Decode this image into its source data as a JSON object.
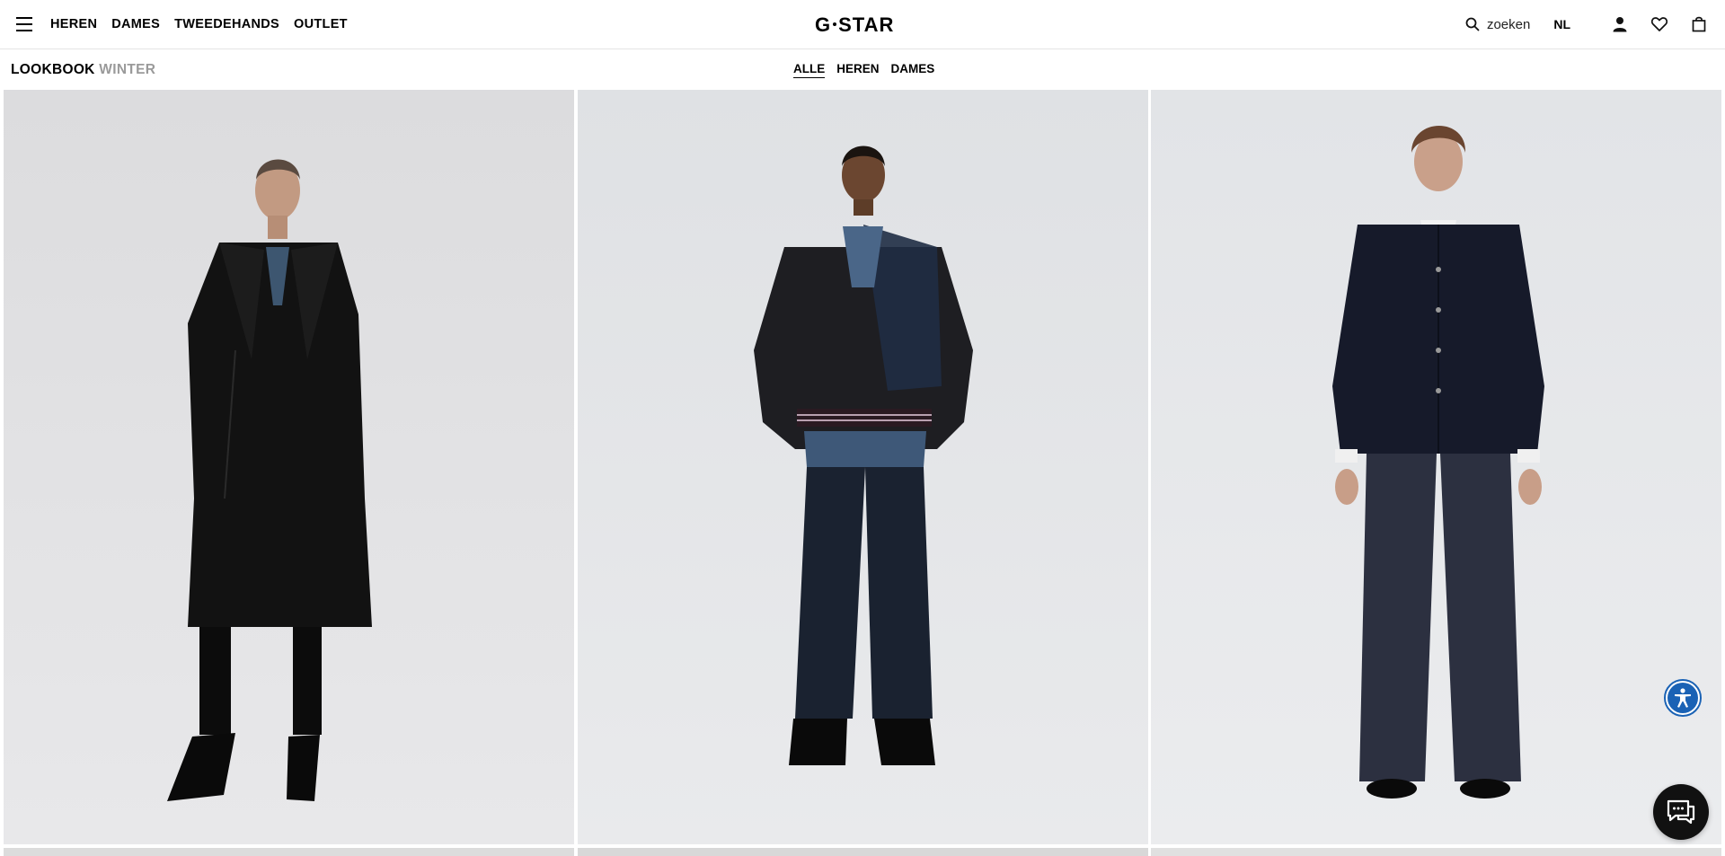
{
  "header": {
    "menu_icon": "hamburger-menu-icon",
    "nav": [
      {
        "label": "HEREN"
      },
      {
        "label": "DAMES"
      },
      {
        "label": "TWEEDEHANDS"
      },
      {
        "label": "OUTLET"
      }
    ],
    "logo_left": "G",
    "logo_right": "STAR",
    "search": {
      "icon": "search-icon",
      "label": "zoeken"
    },
    "language": "NL",
    "icons": [
      "account-icon",
      "wishlist-heart-icon",
      "shopping-bag-icon"
    ]
  },
  "subheader": {
    "title": "LOOKBOOK",
    "subtitle": "WINTER",
    "filters": [
      {
        "label": "ALLE",
        "active": true
      },
      {
        "label": "HEREN",
        "active": false
      },
      {
        "label": "DAMES",
        "active": false
      }
    ]
  },
  "lookbook": {
    "items": [
      {
        "image": "woman-black-long-coat-look"
      },
      {
        "image": "woman-varsity-bomber-flare-jeans-look"
      },
      {
        "image": "man-navy-denim-jacket-wide-jeans-look"
      }
    ]
  },
  "floating": {
    "accessibility_icon": "accessibility-icon",
    "chat_icon": "chat-support-icon"
  },
  "colors": {
    "accent_blue": "#1a62b5",
    "text": "#000000",
    "muted": "#9a9a9a",
    "photo_bg": "#e6e6e8"
  }
}
